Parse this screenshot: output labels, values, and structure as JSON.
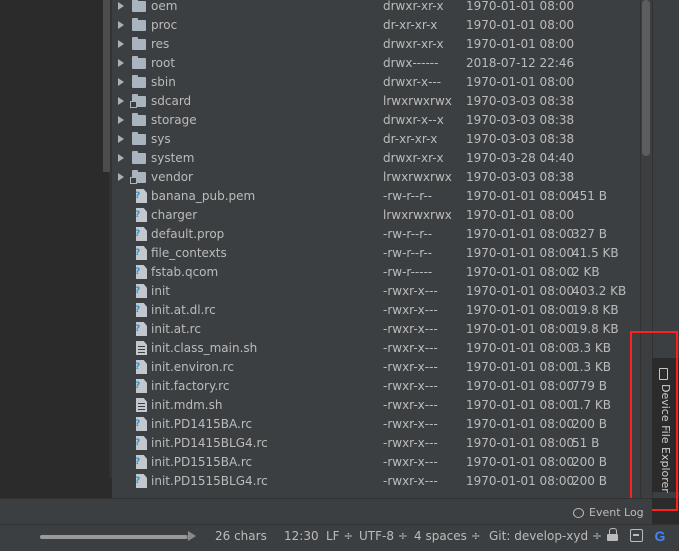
{
  "file_tree": {
    "rows": [
      {
        "kind": "folder",
        "name": "oem",
        "perm": "drwxr-xr-x",
        "date": "1970-01-01 08:00",
        "size": ""
      },
      {
        "kind": "folder",
        "name": "proc",
        "perm": "dr-xr-xr-x",
        "date": "1970-01-01 08:00",
        "size": ""
      },
      {
        "kind": "folder",
        "name": "res",
        "perm": "drwxr-xr-x",
        "date": "1970-01-01 08:00",
        "size": ""
      },
      {
        "kind": "folder",
        "name": "root",
        "perm": "drwx------",
        "date": "2018-07-12 22:46",
        "size": ""
      },
      {
        "kind": "folder",
        "name": "sbin",
        "perm": "drwxr-x---",
        "date": "1970-01-01 08:00",
        "size": ""
      },
      {
        "kind": "folder-link",
        "name": "sdcard",
        "perm": "lrwxrwxrwx",
        "date": "1970-03-03 08:38",
        "size": ""
      },
      {
        "kind": "folder",
        "name": "storage",
        "perm": "drwxr-x--x",
        "date": "1970-03-03 08:38",
        "size": ""
      },
      {
        "kind": "folder",
        "name": "sys",
        "perm": "dr-xr-xr-x",
        "date": "1970-03-03 08:38",
        "size": ""
      },
      {
        "kind": "folder",
        "name": "system",
        "perm": "drwxr-xr-x",
        "date": "1970-03-28 04:40",
        "size": ""
      },
      {
        "kind": "folder-link",
        "name": "vendor",
        "perm": "lrwxrwxrwx",
        "date": "1970-03-03 08:38",
        "size": ""
      },
      {
        "kind": "file-unknown",
        "name": "banana_pub.pem",
        "perm": "-rw-r--r--",
        "date": "1970-01-01 08:00",
        "size": "451 B"
      },
      {
        "kind": "file-unknown",
        "name": "charger",
        "perm": "lrwxrwxrwx",
        "date": "1970-01-01 08:00",
        "size": ""
      },
      {
        "kind": "file-unknown",
        "name": "default.prop",
        "perm": "-rw-r--r--",
        "date": "1970-01-01 08:00",
        "size": "327 B"
      },
      {
        "kind": "file-unknown",
        "name": "file_contexts",
        "perm": "-rw-r--r--",
        "date": "1970-01-01 08:00",
        "size": "41.5 KB"
      },
      {
        "kind": "file-unknown",
        "name": "fstab.qcom",
        "perm": "-rw-r-----",
        "date": "1970-01-01 08:00",
        "size": "2 KB"
      },
      {
        "kind": "file-unknown",
        "name": "init",
        "perm": "-rwxr-x---",
        "date": "1970-01-01 08:00",
        "size": "403.2 KB"
      },
      {
        "kind": "file-unknown",
        "name": "init.at.dl.rc",
        "perm": "-rwxr-x---",
        "date": "1970-01-01 08:00",
        "size": "19.8 KB"
      },
      {
        "kind": "file-unknown",
        "name": "init.at.rc",
        "perm": "-rwxr-x---",
        "date": "1970-01-01 08:00",
        "size": "19.8 KB"
      },
      {
        "kind": "file-text",
        "name": "init.class_main.sh",
        "perm": "-rwxr-x---",
        "date": "1970-01-01 08:00",
        "size": "3.3 KB"
      },
      {
        "kind": "file-unknown",
        "name": "init.environ.rc",
        "perm": "-rwxr-x---",
        "date": "1970-01-01 08:00",
        "size": "1.3 KB"
      },
      {
        "kind": "file-unknown",
        "name": "init.factory.rc",
        "perm": "-rwxr-x---",
        "date": "1970-01-01 08:00",
        "size": "779 B"
      },
      {
        "kind": "file-text",
        "name": "init.mdm.sh",
        "perm": "-rwxr-x---",
        "date": "1970-01-01 08:00",
        "size": "1.7 KB"
      },
      {
        "kind": "file-unknown",
        "name": "init.PD1415BA.rc",
        "perm": "-rwxr-x---",
        "date": "1970-01-01 08:00",
        "size": "200 B"
      },
      {
        "kind": "file-unknown",
        "name": "init.PD1415BLG4.rc",
        "perm": "-rwxr-x---",
        "date": "1970-01-01 08:00",
        "size": "51 B"
      },
      {
        "kind": "file-unknown",
        "name": "init.PD1515BA.rc",
        "perm": "-rwxr-x---",
        "date": "1970-01-01 08:00",
        "size": "200 B"
      },
      {
        "kind": "file-unknown",
        "name": "init.PD1515BLG4.rc",
        "perm": "-rwxr-x---",
        "date": "1970-01-01 08:00",
        "size": "200 B"
      }
    ]
  },
  "side_tab": {
    "label": "Device File Explorer",
    "icon": "device-icon",
    "highlight_color": "#ff2020"
  },
  "tool_strip": {
    "event_log_label": "Event Log",
    "event_log_icon": "speech-bubble-icon"
  },
  "status_bar": {
    "progress": 0.98,
    "chars": "26 chars",
    "position": "12:30",
    "line_separator": "LF ÷",
    "encoding": "UTF-8 ÷",
    "indent": "4 spaces ÷",
    "vcs": "Git: develop-xyd ÷",
    "icons": [
      "lock-icon",
      "inspector-face-icon",
      "google-icon"
    ],
    "google_glyph": "G"
  },
  "colors": {
    "panel_bg": "#3c3f41",
    "editor_bg": "#2b2b2b",
    "text": "#bbbbbb",
    "accent_blue": "#3592c4"
  }
}
